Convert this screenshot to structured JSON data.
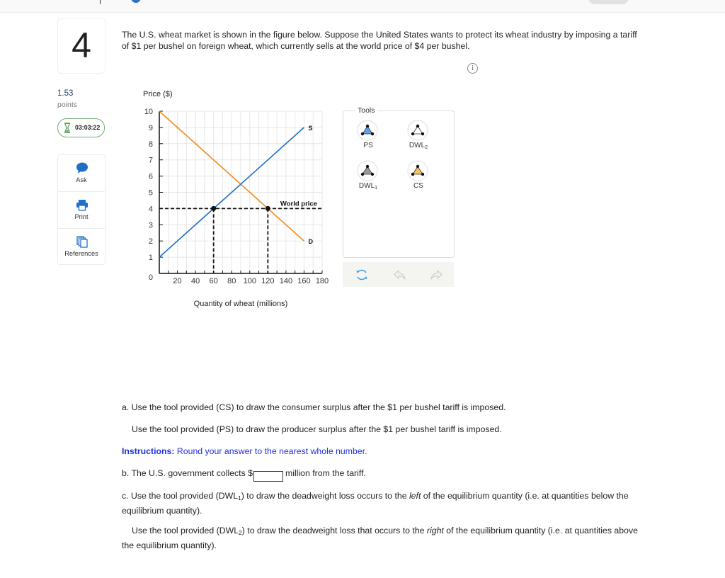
{
  "top_bar": {
    "icons": [
      "divider",
      "progress-circle-icon",
      "menu-pill-button"
    ]
  },
  "question": {
    "number": "4",
    "text_lines": [
      "The U.S. wheat market is shown in the figure below. Suppose the United States wants to protect its wheat industry by imposing a tariff",
      "of $1 per bushel on foreign wheat, which currently sells at the world price of $4 per bushel."
    ],
    "info_icon": "i"
  },
  "score": {
    "value": "1.53",
    "unit": "points"
  },
  "timer": {
    "icon": "hourglass-icon",
    "value": "03:03:22",
    "color": "#5a9e5a"
  },
  "sidebar": {
    "items": [
      {
        "label": "Ask",
        "icon": "speech-bubble-icon"
      },
      {
        "label": "Print",
        "icon": "printer-icon"
      },
      {
        "label": "References",
        "icon": "documents-icon"
      }
    ],
    "icon_color": "#1f6fc8"
  },
  "graph_tools": {
    "title": "Tools",
    "tools": [
      {
        "label": "PS",
        "sub": "",
        "color": "#5ea3ea"
      },
      {
        "label": "DWL",
        "sub": "2",
        "color": "#ffffff"
      },
      {
        "label": "DWL",
        "sub": "1",
        "color": "#9a9a9a"
      },
      {
        "label": "CS",
        "sub": "",
        "color": "#f5c25c"
      }
    ],
    "actions": [
      {
        "name": "reset",
        "icon": "refresh-icon",
        "color": "#3a9ee4"
      },
      {
        "name": "undo",
        "icon": "undo-icon",
        "color": "#cccccc"
      },
      {
        "name": "redo",
        "icon": "redo-icon",
        "color": "#cccccc"
      }
    ]
  },
  "chart_data": {
    "type": "line",
    "title": "",
    "ylabel": "Price ($)",
    "xlabel": "Quantity of wheat (millions)",
    "xlim": [
      0,
      180
    ],
    "ylim": [
      0,
      10
    ],
    "xticks": [
      20,
      40,
      60,
      80,
      100,
      120,
      140,
      160,
      180
    ],
    "x_minor_step": 10,
    "yticks": [
      0,
      1,
      2,
      3,
      4,
      5,
      6,
      7,
      8,
      9,
      10
    ],
    "grid": true,
    "series": [
      {
        "name": "D",
        "label": "D",
        "color": "#f08a1c",
        "points": [
          [
            0,
            10
          ],
          [
            160,
            2
          ]
        ]
      },
      {
        "name": "S",
        "label": "S",
        "color": "#1f6fc5",
        "points": [
          [
            0,
            1
          ],
          [
            160,
            9
          ]
        ]
      }
    ],
    "reference_lines": [
      {
        "name": "World price",
        "label": "World price",
        "y": 4,
        "style": "dashed",
        "color": "#111111"
      }
    ],
    "drop_lines": [
      {
        "x": 60,
        "y": 4
      },
      {
        "x": 120,
        "y": 4
      }
    ],
    "marked_points": [
      {
        "x": 60,
        "y": 4
      },
      {
        "x": 120,
        "y": 4
      }
    ]
  },
  "parts": {
    "a": {
      "line1": "a. Use the tool provided (CS) to draw the consumer surplus after the $1 per bushel tariff is imposed.",
      "line2": "Use the tool provided (PS) to draw the producer surplus after the $1 per bushel tariff is imposed."
    },
    "instructions": {
      "label": "Instructions:",
      "text": " Round your answer to the nearest whole number."
    },
    "b": {
      "prefix": "b. The U.S. government collects $",
      "value": "",
      "suffix": "million from the tariff."
    },
    "c": {
      "pre": "c. Use the tool provided (DWL",
      "sub": "1",
      "mid": ") to draw the deadweight loss occurs to the ",
      "em": "left",
      "post1": " of the equilibrium quantity (i.e. at quantities below the",
      "post2": "equilibrium quantity)."
    },
    "c2": {
      "pre": "Use the tool provided (DWL",
      "sub": "2",
      "mid": ") to draw the deadweight loss that occurs to the ",
      "em": "right",
      "post1": " of the equilibrium quantity (i.e. at quantities above",
      "post2": "the equilibrium quantity)."
    }
  }
}
